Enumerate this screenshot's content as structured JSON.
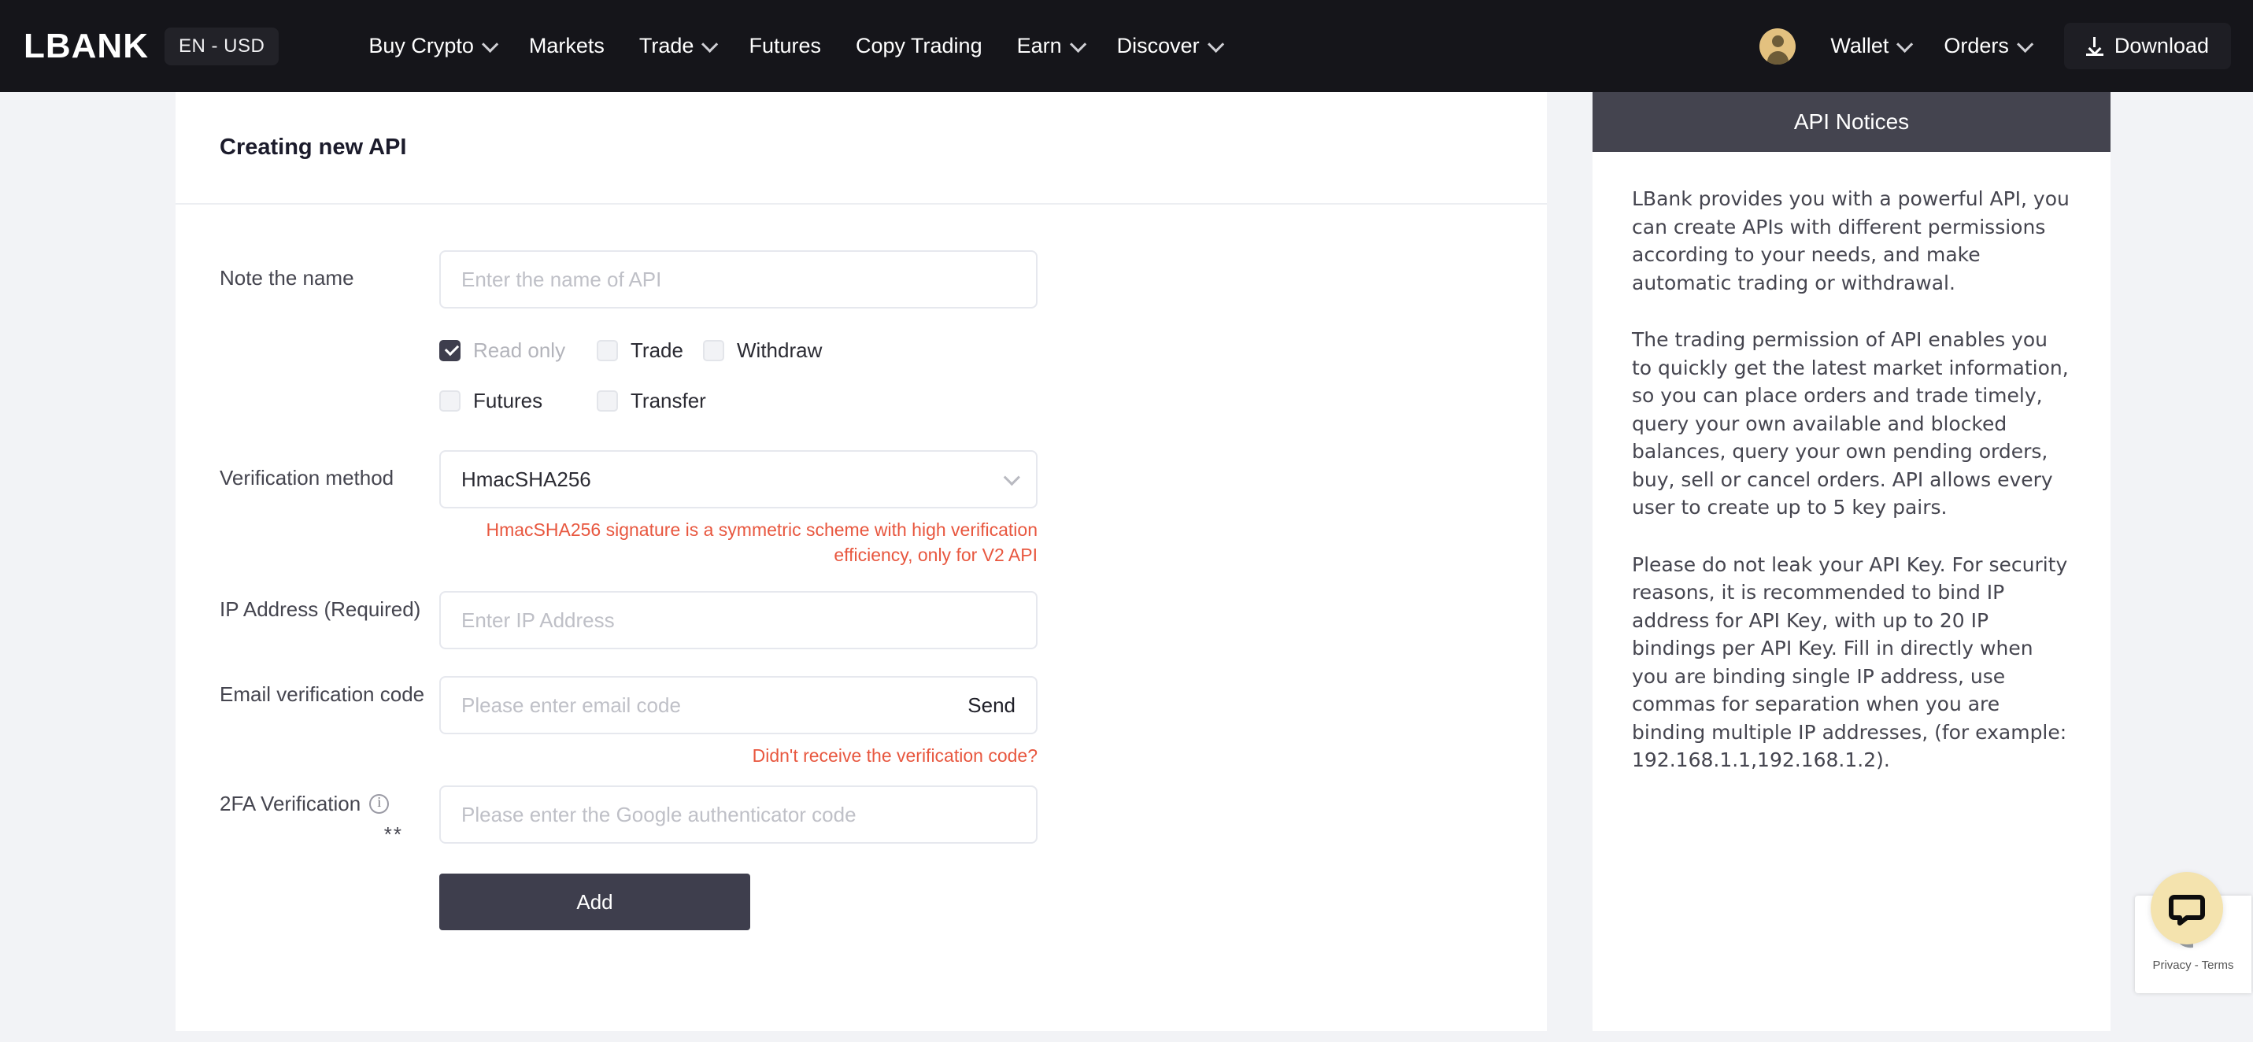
{
  "brand": {
    "logo_text": "LBANK",
    "lang_currency": "EN - USD",
    "accent_red": "#e8573f",
    "dark": "#15151a",
    "panel_dark": "#44444f",
    "avatar_gold": "#e3c17f",
    "chat_yellow": "#f4e3ae"
  },
  "nav": {
    "items": [
      {
        "label": "Buy Crypto",
        "has_caret": true
      },
      {
        "label": "Markets",
        "has_caret": false
      },
      {
        "label": "Trade",
        "has_caret": true
      },
      {
        "label": "Futures",
        "has_caret": false
      },
      {
        "label": "Copy Trading",
        "has_caret": false
      },
      {
        "label": "Earn",
        "has_caret": true
      },
      {
        "label": "Discover",
        "has_caret": true
      }
    ],
    "right": {
      "wallet_label": "Wallet",
      "orders_label": "Orders",
      "download_label": "Download"
    }
  },
  "card": {
    "title": "Creating new API",
    "fields": {
      "name_label": "Note the name",
      "name_placeholder": "Enter the name of API",
      "name_value": "",
      "verification_label": "Verification method",
      "verification_value": "HmacSHA256",
      "verification_hint": "HmacSHA256 signature is a symmetric scheme with high verification efficiency, only for V2 API",
      "ip_label": "IP Address (Required)",
      "ip_placeholder": "Enter IP Address",
      "ip_value": "",
      "email_label": "Email verification code",
      "email_placeholder": "Please enter email code",
      "email_value": "",
      "send_label": "Send",
      "resend_link": "Didn't receive the verification code?",
      "twofa_label": "2FA Verification",
      "twofa_stars": "**",
      "twofa_placeholder": "Please enter the Google authenticator code",
      "twofa_value": ""
    },
    "permissions": [
      {
        "label": "Read only",
        "checked": true,
        "disabled": true
      },
      {
        "label": "Trade",
        "checked": false,
        "disabled": false
      },
      {
        "label": "Withdraw",
        "checked": false,
        "disabled": false
      },
      {
        "label": "Futures",
        "checked": false,
        "disabled": false
      },
      {
        "label": "Transfer",
        "checked": false,
        "disabled": false
      }
    ],
    "submit_label": "Add"
  },
  "side_panel": {
    "title": "API Notices",
    "paragraphs": [
      "LBank provides you with a powerful API, you can create APIs with different permissions according to your needs, and make automatic trading or withdrawal.",
      "The trading permission of API enables you to quickly get the latest market information, so you can place orders and trade timely, query your own available and blocked balances, query your own pending orders, buy, sell or cancel orders. API allows every user to create up to 5 key pairs.",
      "Please do not leak your API Key. For security reasons, it is recommended to bind IP address for API Key, with up to 20 IP bindings per API Key. Fill in directly when you are binding single IP address, use commas for separation when you are binding multiple IP addresses, (for example: 192.168.1.1,192.168.1.2)."
    ]
  },
  "widgets": {
    "recaptcha_text": "Privacy - Terms"
  }
}
